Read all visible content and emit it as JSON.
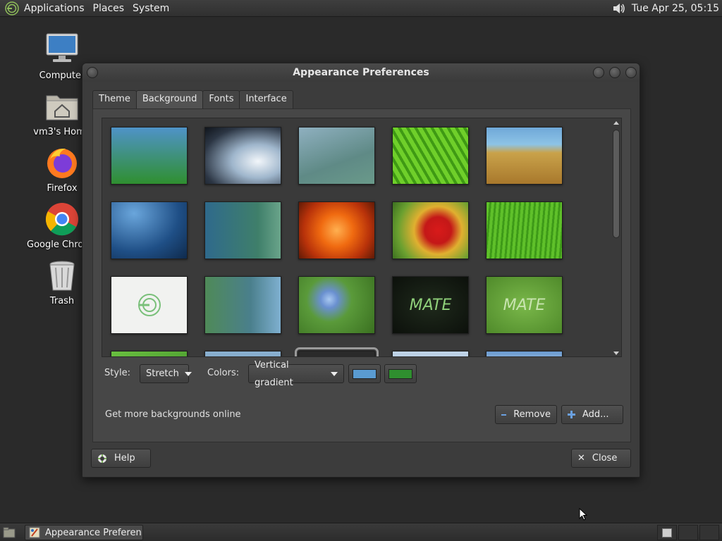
{
  "top_panel": {
    "menus": [
      "Applications",
      "Places",
      "System"
    ],
    "clock": "Tue Apr 25, 05:15"
  },
  "desktop": {
    "icons": [
      {
        "label": "Computer",
        "icon": "computer-icon"
      },
      {
        "label": "vm3's Home",
        "icon": "home-folder-icon"
      },
      {
        "label": "Firefox",
        "icon": "firefox-icon"
      },
      {
        "label": "Google Chrome",
        "icon": "chrome-icon"
      },
      {
        "label": "Trash",
        "icon": "trash-icon"
      }
    ]
  },
  "window": {
    "title": "Appearance Preferences",
    "tabs": [
      "Theme",
      "Background",
      "Fonts",
      "Interface"
    ],
    "active_tab": "Background",
    "style_label": "Style:",
    "style_value": "Stretch",
    "colors_label": "Colors:",
    "colors_value": "Vertical gradient",
    "color_primary": "#5a9bd1",
    "color_secondary": "#2f8f2f",
    "get_more": "Get more backgrounds online",
    "remove_label": "Remove",
    "add_label": "Add...",
    "help_label": "Help",
    "close_label": "Close",
    "thumb_text": "MATE"
  },
  "taskbar": {
    "task_label": "Appearance Preferen..."
  }
}
